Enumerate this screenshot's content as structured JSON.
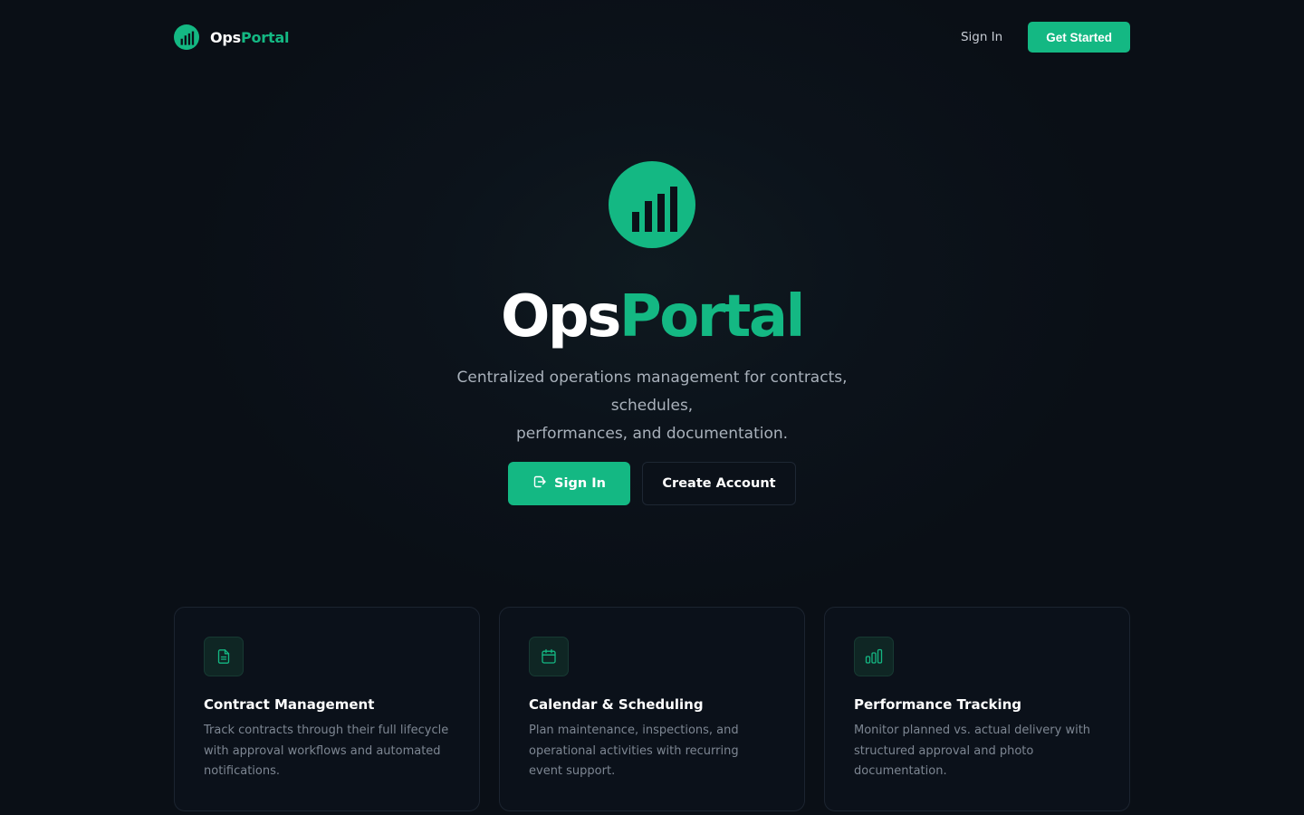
{
  "brand": {
    "name_part1": "Ops",
    "name_part2": "Portal"
  },
  "nav": {
    "signin_label": "Sign In",
    "get_started_label": "Get Started"
  },
  "hero": {
    "title_part1": "Ops",
    "title_part2": "Portal",
    "subtitle_line1": "Centralized operations management for contracts, schedules,",
    "subtitle_line2": "performances, and documentation.",
    "signin_label": "Sign In",
    "create_account_label": "Create Account"
  },
  "features": [
    {
      "icon": "document-icon",
      "title": "Contract Management",
      "description": "Track contracts through their full lifecycle with approval workflows and automated notifications."
    },
    {
      "icon": "calendar-icon",
      "title": "Calendar & Scheduling",
      "description": "Plan maintenance, inspections, and operational activities with recurring event support."
    },
    {
      "icon": "bar-chart-icon",
      "title": "Performance Tracking",
      "description": "Monitor planned vs. actual delivery with structured approval and photo documentation."
    }
  ],
  "colors": {
    "accent": "#14b883",
    "background": "#0b1018"
  }
}
